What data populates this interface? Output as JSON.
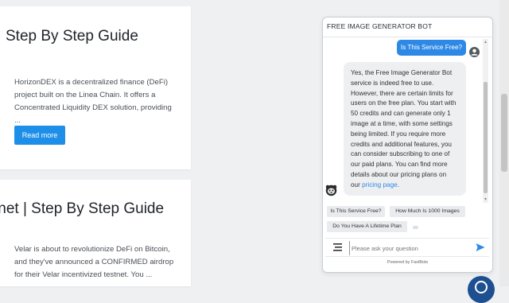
{
  "cards": [
    {
      "title": "Step By Step Guide",
      "excerpt": "HorizonDEX is a decentralized finance (DeFi)\nproject built on the Linea Chain. It offers a\nConcentrated Liquidity DEX solution, providing\n...",
      "button": "Read more"
    },
    {
      "title": "tnet | Step By Step Guide",
      "excerpt": "Velar is about to revolutionize DeFi on Bitcoin,\nand they've announced a CONFIRMED airdrop\nfor their Velar incentivized testnet. You ..."
    }
  ],
  "chat": {
    "title": "FREE IMAGE GENERATOR BOT",
    "user_message": "Is This Service Free?",
    "bot_message": "Yes, the Free Image Generator Bot\nservice is indeed free to use.\nHowever, there are certain limits for\nusers on the free plan. You start with\n50 credits and can generate only 1\nimage at a time, with some settings\nbeing limited. If you require more\ncredits and additional features, you\ncan consider subscribing to one of\nour paid plans. You can find more\ndetails about our pricing plans on\nour ",
    "bot_link": "pricing page",
    "bot_tail": ".",
    "suggestions": [
      "Is This Service Free?",
      "How Much Is 1000 Images",
      "Do You Have A Lifetime Plan"
    ],
    "input_placeholder": "Please ask your question",
    "powered_by": "Powered by FastBots"
  },
  "icons": {
    "user_avatar": "user-circle-icon",
    "bot_avatar": "bot-avatar-icon",
    "menu": "menu-lines-icon",
    "send": "send-arrow-icon",
    "launcher": "chat-launcher-icon"
  },
  "colors": {
    "accent": "#2e89e6",
    "button": "#1e8fe8",
    "bot_bubble": "#eeeff1",
    "launcher": "#1d4f91"
  }
}
